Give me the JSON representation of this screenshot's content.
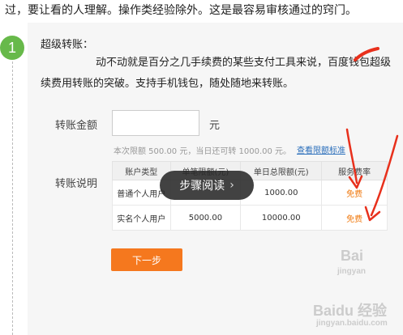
{
  "intro_text": "过，要让看的人理解。操作类经验除外。这是最容易审核通过的窍门。",
  "step": {
    "number": "1",
    "title": "超级转账：",
    "line1": "动不动就是百分之几手续费的某些支付工具来说，百度钱包超级",
    "line2": "续费用转账的突破。支持手机钱包，随处随地来转账。"
  },
  "form": {
    "amount_label": "转账金额",
    "amount_value": "",
    "unit": "元",
    "limit_note": "本次限额 500.00 元，当日还可转 1000.00 元。",
    "limit_link": "查看限额标准",
    "desc_label": "转账说明"
  },
  "table": {
    "headers": [
      "账户类型",
      "单笔限额(元)",
      "单日总限额(元)",
      "服务费率"
    ],
    "rows": [
      [
        "普通个人用户",
        "",
        "1000.00",
        "免费"
      ],
      [
        "实名个人用户",
        "5000.00",
        "10000.00",
        "免费"
      ]
    ]
  },
  "next_button": "下一步",
  "overlay": {
    "label": "步骤阅读",
    "chevron": "›"
  },
  "watermarks": [
    "Bai",
    "jingyan",
    "Baidu 经验",
    "jingyan.baidu.com"
  ],
  "colors": {
    "accent": "#f5781e",
    "step_green": "#67b94a",
    "link": "#2a6ebb",
    "annotation": "#e8301c"
  }
}
